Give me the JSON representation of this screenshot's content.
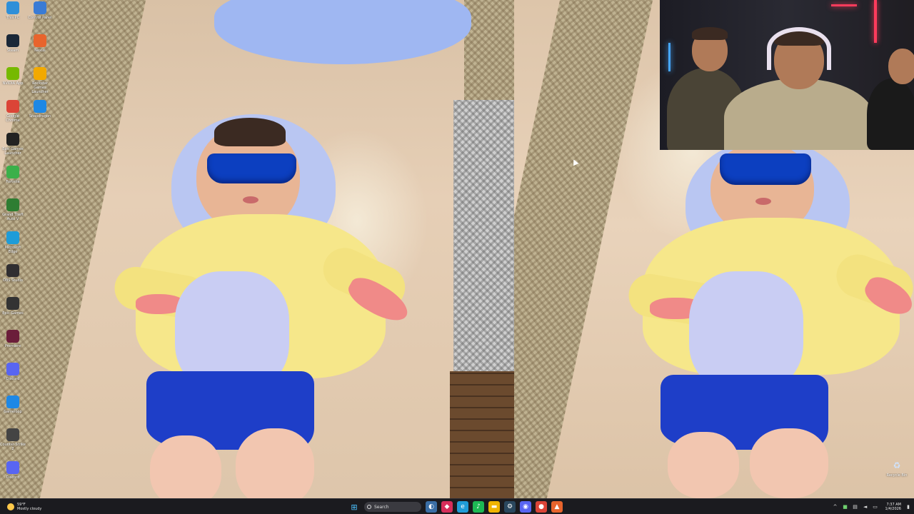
{
  "desktop": {
    "icons_col1": [
      {
        "label": "This PC",
        "icon": "computer-icon",
        "color": "#2f8fd8"
      },
      {
        "label": "Steam",
        "icon": "steam-icon",
        "color": "#1b2838"
      },
      {
        "label": "NVIDIA App",
        "icon": "nvidia-icon",
        "color": "#76b900"
      },
      {
        "label": "Google Chrome",
        "icon": "chrome-icon",
        "color": "#db4437"
      },
      {
        "label": "Epic Games Launcher",
        "icon": "epic-icon",
        "color": "#222222"
      },
      {
        "label": "Fortnite",
        "icon": "fortnite-icon",
        "color": "#3bb04a"
      },
      {
        "label": "Grand Theft Auto V",
        "icon": "gta-icon",
        "color": "#2e7d32"
      },
      {
        "label": "Microsoft Edge",
        "icon": "edge-icon",
        "color": "#1f9cd8"
      },
      {
        "label": "OBS Studio",
        "icon": "obs-icon",
        "color": "#302e31"
      },
      {
        "label": "Epic Games",
        "icon": "epic-games-icon",
        "color": "#333333"
      },
      {
        "label": "Premiere",
        "icon": "premiere-icon",
        "color": "#6b1e3a"
      },
      {
        "label": "Discord",
        "icon": "discord-icon",
        "color": "#5865f2"
      },
      {
        "label": "Gameloop",
        "icon": "gameloop-icon",
        "color": "#1e88e5"
      },
      {
        "label": "Counter-Strike 2",
        "icon": "cs2-icon",
        "color": "#444444"
      },
      {
        "label": "Discord",
        "icon": "discord-icon",
        "color": "#5865f2"
      }
    ],
    "icons_col2": [
      {
        "label": "Control Panel",
        "icon": "control-panel-icon",
        "color": "#3a7bd5"
      },
      {
        "label": "Nexus",
        "icon": "nexus-icon",
        "color": "#e8642c"
      },
      {
        "label": "Rockstar Games Launcher",
        "icon": "rockstar-icon",
        "color": "#f2a900"
      },
      {
        "label": "Snapdragon",
        "icon": "window-icon",
        "color": "#1e88e5"
      }
    ],
    "recycle_bin": {
      "label": "Recycle Bin",
      "icon": "recycle-bin-icon"
    }
  },
  "taskbar": {
    "weather": {
      "temp": "59°F",
      "desc": "Mostly cloudy",
      "icon": "cloud-sun-icon"
    },
    "start_icon": "windows-start-icon",
    "search_label": "Search",
    "apps": [
      {
        "name": "widgets",
        "glyph": "◐",
        "color": "#3a6ea5"
      },
      {
        "name": "app",
        "glyph": "◆",
        "color": "#d62d5a"
      },
      {
        "name": "edge",
        "glyph": "e",
        "color": "#1f9cd8"
      },
      {
        "name": "spotify",
        "glyph": "♪",
        "color": "#1db954"
      },
      {
        "name": "file-explorer",
        "glyph": "▬",
        "color": "#f0b400"
      },
      {
        "name": "steam",
        "glyph": "⚙",
        "color": "#2a475e"
      },
      {
        "name": "discord",
        "glyph": "◉",
        "color": "#5865f2"
      },
      {
        "name": "chrome",
        "glyph": "●",
        "color": "#db4437"
      },
      {
        "name": "app-orange",
        "glyph": "▲",
        "color": "#e8642c"
      }
    ],
    "tray": {
      "chevron": "^",
      "clock_time": "7:37 AM",
      "clock_date": "1/4/2026"
    }
  }
}
